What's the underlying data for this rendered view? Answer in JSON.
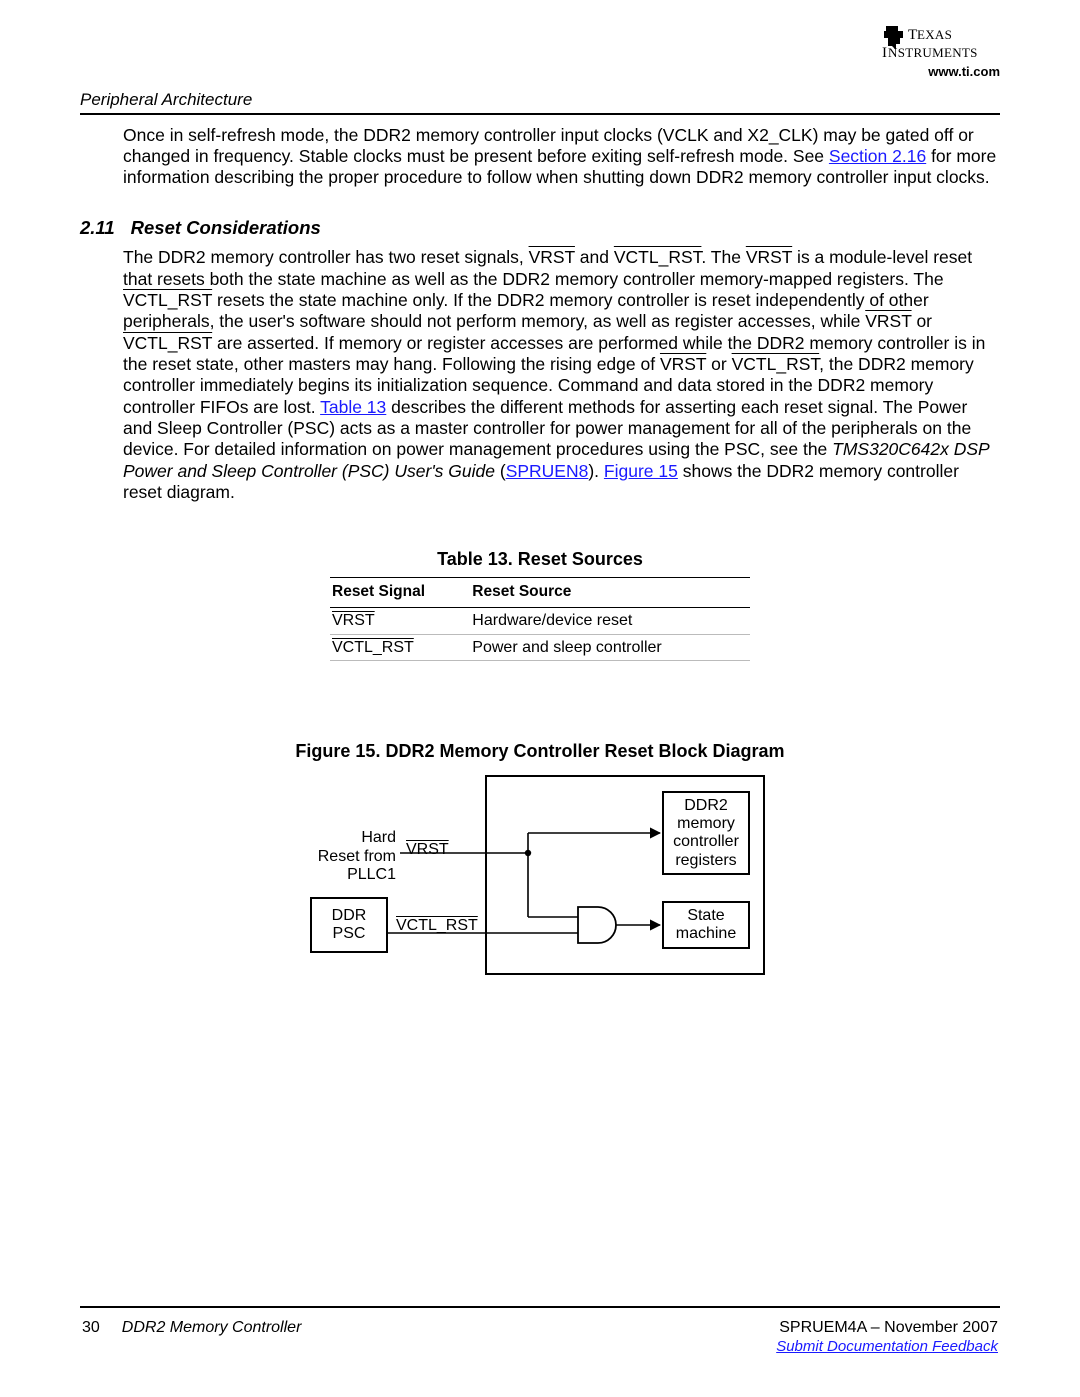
{
  "header": {
    "url": "www.ti.com",
    "section_label": "Peripheral Architecture"
  },
  "intro_paragraph": "Once in self-refresh mode, the DDR2 memory controller input clocks (VCLK and X2_CLK) may be gated off or changed in frequency. Stable clocks must be present before exiting self-refresh mode. See ",
  "intro_link": "Section 2.16",
  "intro_after": " for more information describing the proper procedure to follow when shutting down DDR2 memory controller input clocks.",
  "section": {
    "number": "2.11",
    "title": "Reset Considerations"
  },
  "p2": {
    "t1": "The DDR2 memory controller has two reset signals, ",
    "s_vrst": "VRST",
    "t2": " and ",
    "s_vctl": "VCTL_RST",
    "t3": ". The ",
    "t4": " is a module-level reset that resets both the state machine as well as the DDR2 memory controller memory-mapped registers. The ",
    "t5": " resets the state machine only. If the DDR2 memory controller is reset independently of other peripherals, the user's software should not perform memory, as well as register accesses, while ",
    "t6": " or ",
    "t7": " are asserted. If memory or register accesses are performed while the DDR2 memory controller is in the reset state, other masters may hang. Following the rising edge of ",
    "t8": ", the DDR2 memory controller immediately begins its initialization sequence. Command and data stored in the DDR2 memory controller FIFOs are lost. ",
    "tbl_link": "Table 13",
    "t9": " describes the different methods for asserting each reset signal. The Power and Sleep Controller (PSC) acts as a master controller for power management for all of the peripherals on the device. For detailed information on power management procedures using the PSC, see the ",
    "doc_ref_italic": "TMS320C642x DSP Power and Sleep Controller (PSC) User's Guide",
    "t10": " (",
    "ref_link": "SPRUEN8",
    "t11": "). ",
    "fig_link": "Figure 15",
    "t12": " shows the DDR2 memory controller reset diagram."
  },
  "table": {
    "caption": "Table 13. Reset Sources",
    "headers": [
      "Reset Signal",
      "Reset Source"
    ],
    "rows": [
      {
        "signal": "VRST",
        "source": "Hardware/device reset"
      },
      {
        "signal": "VCTL_RST",
        "source": "Power and sleep controller"
      }
    ]
  },
  "figure": {
    "caption": "Figure 15. DDR2 Memory Controller Reset Block Diagram",
    "labels": {
      "hard_reset": "Hard\nReset from\nPLLC1",
      "ddr_psc": "DDR\nPSC",
      "vrst": "VRST",
      "vctl_rst": "VCTL_RST",
      "ddr2_regs": "DDR2\nmemory\ncontroller\nregisters",
      "state_machine": "State\nmachine"
    }
  },
  "footer": {
    "page_no": "30",
    "doc_title": "DDR2 Memory Controller",
    "pub": "SPRUEM4A – November 2007",
    "feedback": "Submit Documentation Feedback"
  }
}
